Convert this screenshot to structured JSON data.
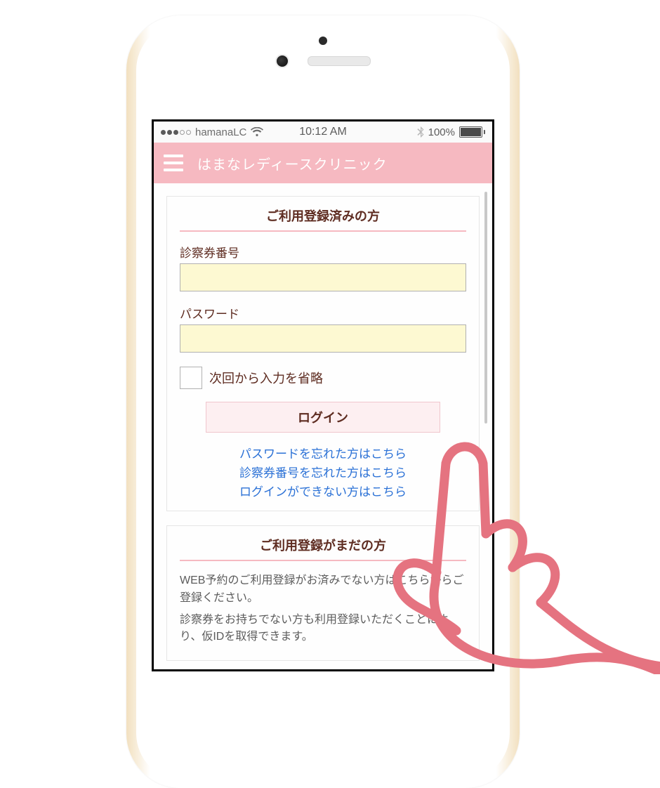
{
  "status_bar": {
    "carrier": "hamanaLC",
    "time": "10:12 AM",
    "battery_pct": "100%"
  },
  "app_header": {
    "title": "はまなレディースクリニック"
  },
  "login_card": {
    "header": "ご利用登録済みの方",
    "field_card_number_label": "診察券番号",
    "field_password_label": "パスワード",
    "remember_label": "次回から入力を省略",
    "login_button": "ログイン",
    "link_forgot_password": "パスワードを忘れた方はこちら",
    "link_forgot_card_number": "診察券番号を忘れた方はこちら",
    "link_cannot_login": "ログインができない方はこちら"
  },
  "register_card": {
    "header": "ご利用登録がまだの方",
    "paragraph1": "WEB予約のご利用登録がお済みでない方はこちらからご登録ください。",
    "paragraph2": "診察券をお持ちでない方も利用登録いただくことにより、仮IDを取得できます。"
  }
}
